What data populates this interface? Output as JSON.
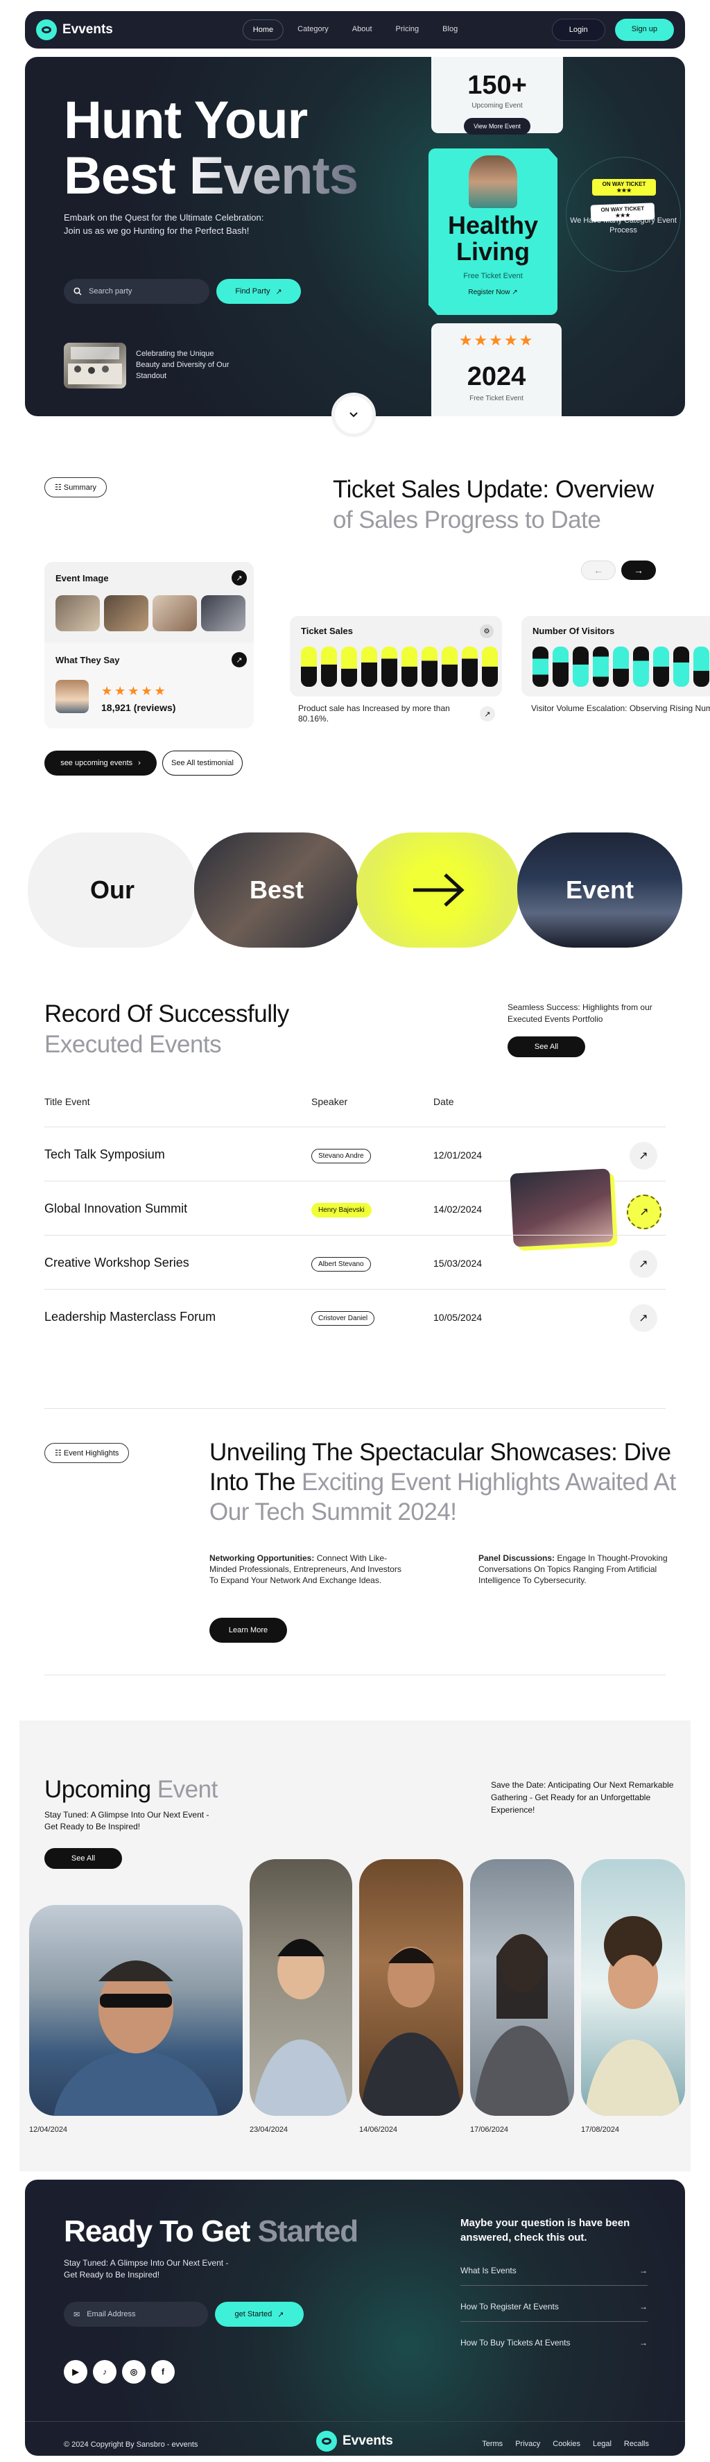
{
  "brand": {
    "name": "Evvents"
  },
  "nav": {
    "items": [
      "Home",
      "Category",
      "About",
      "Pricing",
      "Blog"
    ],
    "login": "Login",
    "signup": "Sign up"
  },
  "hero": {
    "title_line1": "Hunt Your",
    "title_line2": "Best Events",
    "description": "Embark on the Quest for the Ultimate Celebration: Join us as we go Hunting for the Perfect Bash!",
    "search_placeholder": "Search party",
    "find_button": "Find Party",
    "thumb_caption": "Celebrating the Unique Beauty and Diversity of Our Standout",
    "card1": {
      "value": "150+",
      "label": "Upcoming Event",
      "button": "View More Event"
    },
    "card2": {
      "title_line1": "Healthy",
      "title_line2": "Living",
      "subtitle": "Free Ticket Event",
      "button": "Register Now"
    },
    "card3": {
      "stars": "★★★★★",
      "value": "2024",
      "label": "Free Ticket Event"
    },
    "circle_text": "We Have Many Category Event Process",
    "ticket_label": "ON WAY TICKET",
    "ticket_stars": "★★★"
  },
  "summary": {
    "tag": "Summary",
    "title_line1": "Ticket Sales Update: Overview",
    "title_line2": "of Sales Progress to Date",
    "event_image_label": "Event Image",
    "what_they_say_label": "What They Say",
    "review_stars": "★★★★★",
    "reviews": "18,921 (reviews)",
    "ticket_sales_label": "Ticket Sales",
    "ticket_sales_caption": "Product sale has Increased by more than 80.16%.",
    "visitors_label": "Number Of Visitors",
    "visitors_caption": "Visitor Volume Escalation: Observing Rising Numbers with Precision",
    "btn_upcoming": "see upcoming events",
    "btn_testimonial": "See All testimonial",
    "arrow_prev": "←",
    "arrow_next": "→",
    "colors": {
      "accent_yellow": "#f0ff36",
      "accent_teal": "#3ef0d8"
    }
  },
  "our_best_event": {
    "word1": "Our",
    "word2": "Best",
    "word3": "→",
    "word4": "Event"
  },
  "record": {
    "title_line1": "Record Of Successfully",
    "title_line2": "Executed Events",
    "side_text": "Seamless Success: Highlights from our Executed Events Portfolio",
    "see_all": "See All",
    "headers": [
      "Title Event",
      "Speaker",
      "Date"
    ],
    "rows": [
      {
        "title": "Tech Talk Symposium",
        "speaker": "Stevano Andre",
        "date": "12/01/2024"
      },
      {
        "title": "Global Innovation Summit",
        "speaker": "Henry Bajevski",
        "date": "14/02/2024"
      },
      {
        "title": "Creative Workshop Series",
        "speaker": "Albert Stevano",
        "date": "15/03/2024"
      },
      {
        "title": "Leadership Masterclass Forum",
        "speaker": "Cristover Daniel",
        "date": "10/05/2024"
      }
    ]
  },
  "highlights": {
    "tag": "Event Highlights",
    "title_dark1": "Unveiling The Spectacular Showcases: Dive",
    "title_dark2": "Into The",
    "title_muted": "Exciting Event Highlights Awaited At Our Tech Summit 2024!",
    "para1_bold": "Networking Opportunities:",
    "para1_text": "Connect With Like-Minded Professionals, Entrepreneurs, And Investors To Expand Your Network And Exchange Ideas.",
    "para2_bold": "Panel Discussions:",
    "para2_text": "Engage In Thought-Provoking Conversations On Topics Ranging From Artificial Intelligence To Cybersecurity.",
    "learn_more": "Learn More"
  },
  "upcoming": {
    "title_dark": "Upcoming",
    "title_muted": "Event",
    "subtitle": "Stay Tuned: A Glimpse Into Our Next Event - Get Ready to Be Inspired!",
    "see_all": "See All",
    "side_text": "Save the Date: Anticipating Our Next Remarkable Gathering - Get Ready for an Unforgettable Experience!",
    "dates": [
      "12/04/2024",
      "23/04/2024",
      "14/06/2024",
      "17/06/2024",
      "17/08/2024"
    ]
  },
  "cta": {
    "title_dark": "Ready To Get",
    "title_muted": "Started",
    "subtitle": "Stay Tuned: A Glimpse Into Our Next Event - Get Ready to Be Inspired!",
    "email_placeholder": "Email Address",
    "get_started": "get Started",
    "faq_title": "Maybe your question is have been answered, check this out.",
    "faqs": [
      "What Is Events",
      "How To Register At Events",
      "How To Buy Tickets At Events"
    ],
    "socials": [
      "▶",
      "♪",
      "◎",
      "f"
    ]
  },
  "footer": {
    "copyright": "© 2024 Copyright By Sansbro - evvents",
    "links": [
      "Terms",
      "Privacy",
      "Cookies",
      "Legal",
      "Recalls"
    ]
  }
}
